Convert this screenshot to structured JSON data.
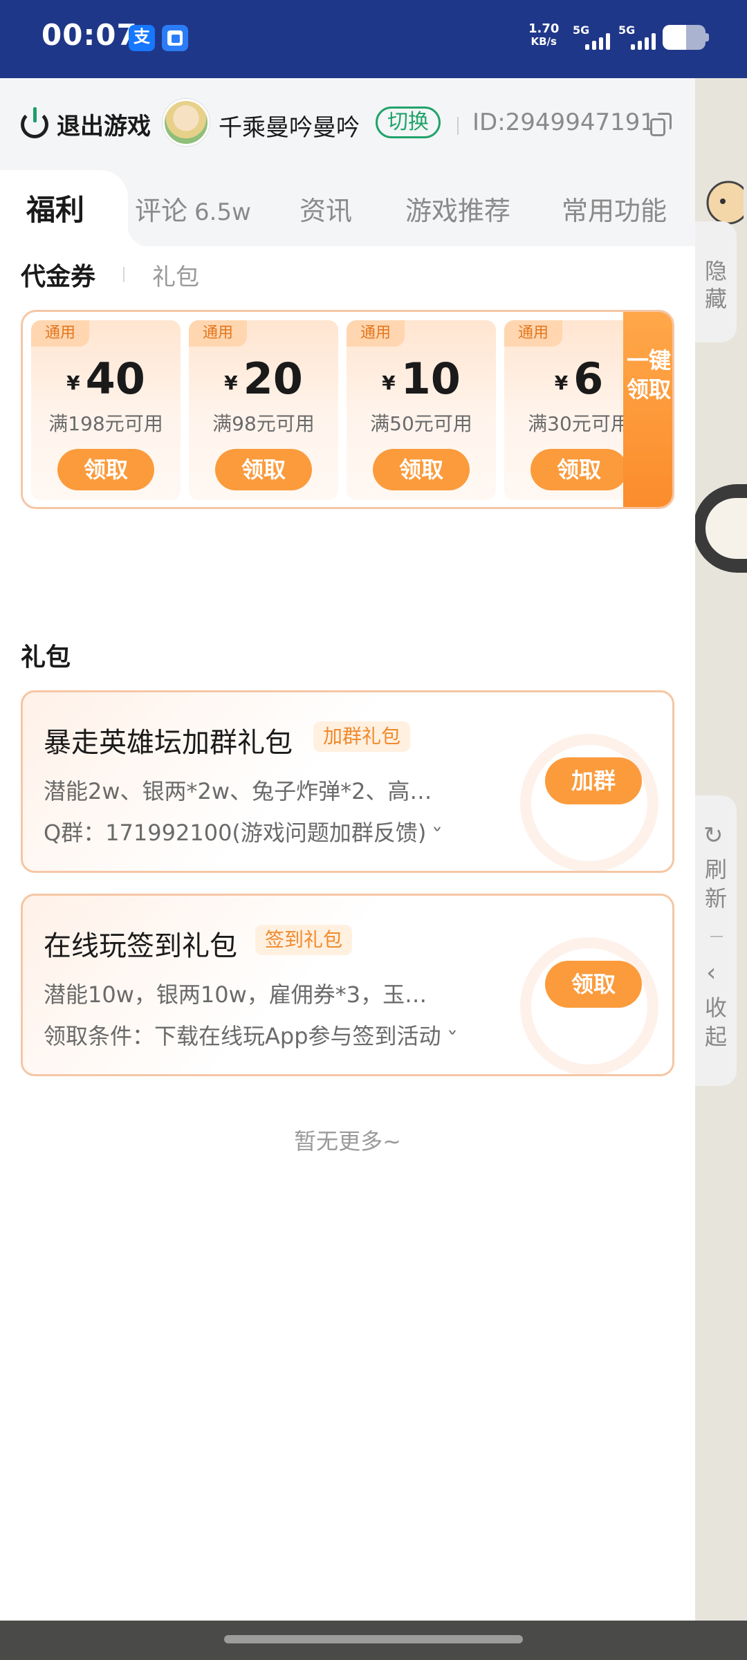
{
  "status_bar": {
    "time": "00:07",
    "app1_glyph": "支",
    "net_speed_value": "1.70",
    "net_speed_unit": "KB/s",
    "sim1": "5G",
    "sim2": "5G",
    "battery_level": 0.55
  },
  "header": {
    "exit_label": "退出游戏",
    "username": "千乘曼吟曼吟",
    "switch_label": "切换",
    "user_id": "ID:2949947191"
  },
  "tabs": [
    {
      "label": "福利",
      "count": "",
      "active": true
    },
    {
      "label": "评论",
      "count": "6.5w",
      "active": false
    },
    {
      "label": "资讯",
      "count": "",
      "active": false
    },
    {
      "label": "游戏推荐",
      "count": "",
      "active": false
    },
    {
      "label": "常用功能",
      "count": "",
      "active": false
    }
  ],
  "subtabs": {
    "active": "代金券",
    "other": "礼包"
  },
  "coupons": [
    {
      "tag": "通用",
      "currency": "¥",
      "amount": "40",
      "condition": "满198元可用",
      "button": "领取"
    },
    {
      "tag": "通用",
      "currency": "¥",
      "amount": "20",
      "condition": "满98元可用",
      "button": "领取"
    },
    {
      "tag": "通用",
      "currency": "¥",
      "amount": "10",
      "condition": "满50元可用",
      "button": "领取"
    },
    {
      "tag": "通用",
      "currency": "¥",
      "amount": "6",
      "condition": "满30元可用",
      "button": "领取"
    }
  ],
  "claim_all_label": "一键领取",
  "gift_section_title": "礼包",
  "gifts": [
    {
      "name": "暴走英雄坛加群礼包",
      "badge": "加群礼包",
      "desc": "潜能2w、银两*2w、兔子炸弹*2、高…",
      "extra": "Q群：171992100(游戏问题加群反馈)",
      "button": "加群"
    },
    {
      "name": "在线玩签到礼包",
      "badge": "签到礼包",
      "desc": "潜能10w，银两10w，雇佣券*3，玉…",
      "extra": "领取条件：下载在线玩App参与签到活动",
      "button": "领取"
    }
  ],
  "no_more": "暂无更多~",
  "side": {
    "hide_label": "隐藏",
    "refresh_label": "刷新",
    "collapse_label": "收起"
  },
  "colors": {
    "status_bar": "#1f3788",
    "accent_green": "#20a36a",
    "accent_orange": "#fb9b3c"
  }
}
